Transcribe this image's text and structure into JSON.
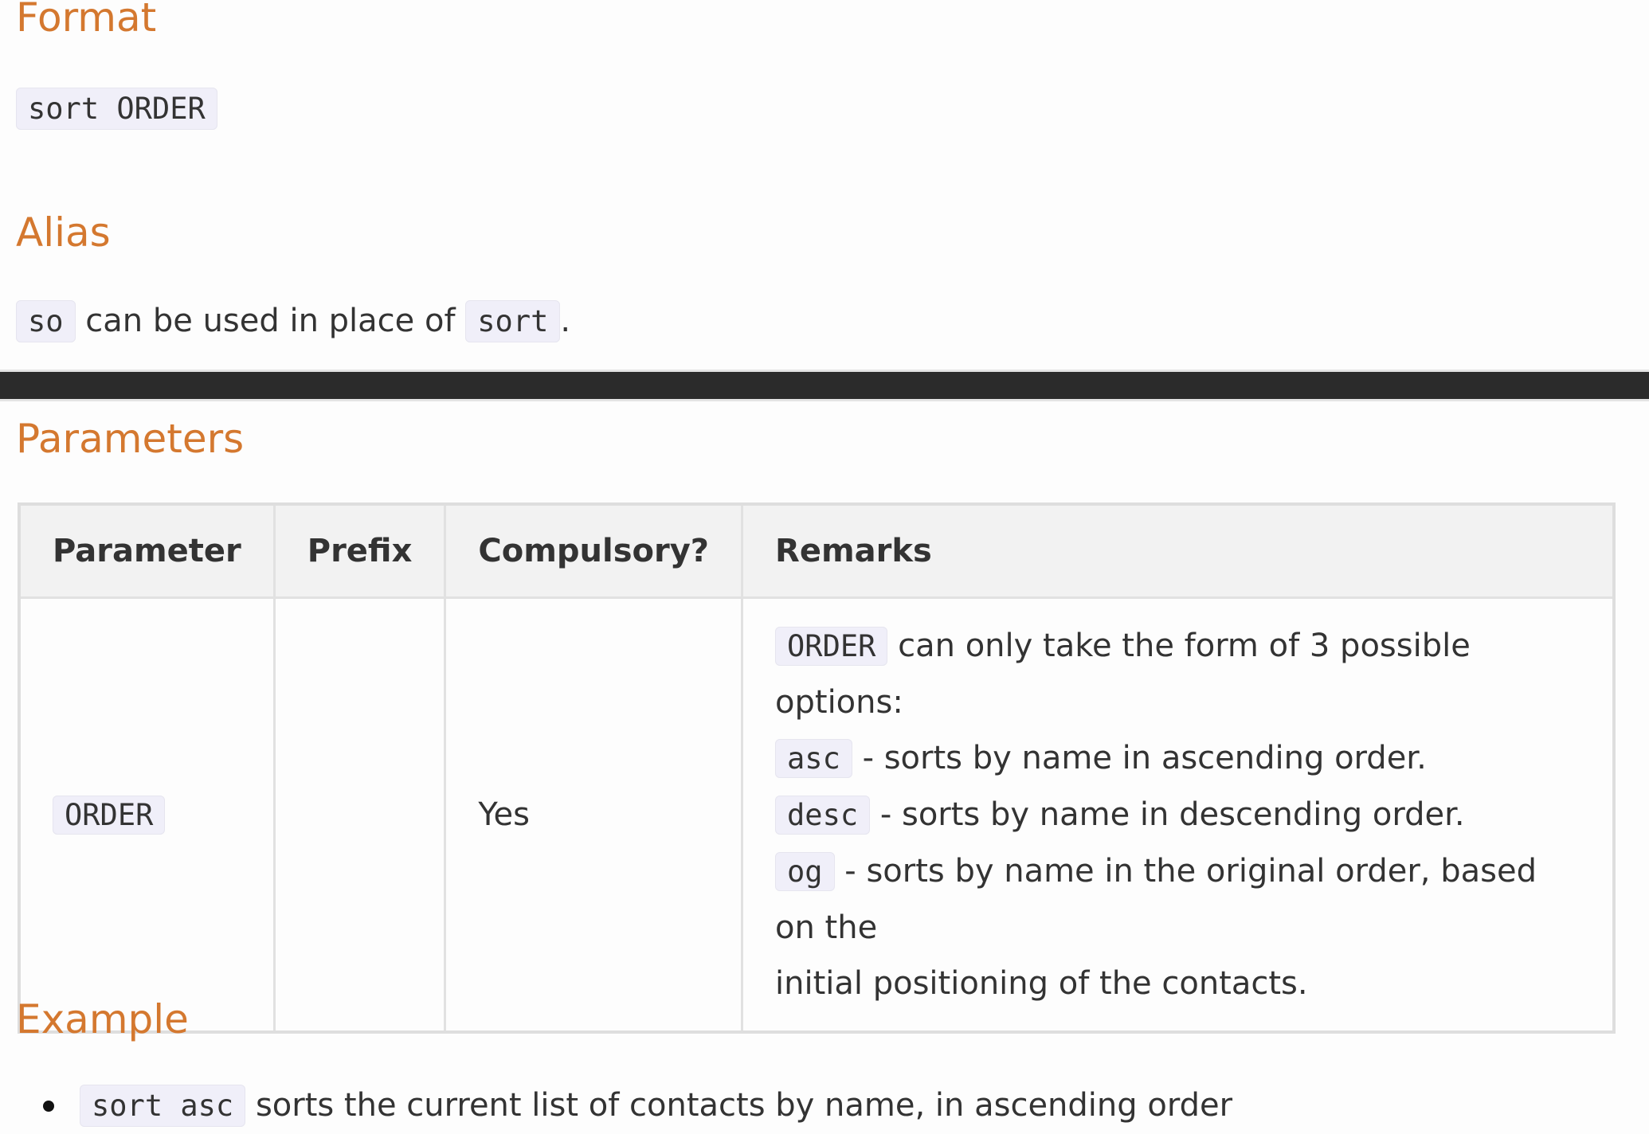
{
  "format": {
    "heading": "Format",
    "command": "sort ORDER"
  },
  "alias": {
    "heading": "Alias",
    "alias_code": "so",
    "text_middle": "can be used in place of",
    "original_code": "sort",
    "text_end": "."
  },
  "parameters": {
    "heading": "Parameters",
    "columns": [
      "Parameter",
      "Prefix",
      "Compulsory?",
      "Remarks"
    ],
    "row": {
      "parameter": "ORDER",
      "prefix": "",
      "compulsory": "Yes",
      "remarks": {
        "intro_code": "ORDER",
        "intro_text": "can only take the form of 3 possible options:",
        "options": [
          {
            "code": "asc",
            "text": "- sorts by name in ascending order."
          },
          {
            "code": "desc",
            "text": "- sorts by name in descending order."
          },
          {
            "code": "og",
            "text": "- sorts by name in the original order, based on the"
          }
        ],
        "continuation": "initial positioning of the contacts."
      }
    }
  },
  "example": {
    "heading": "Example",
    "items": [
      {
        "code": "sort asc",
        "text": "sorts the current list of contacts by name, in ascending order"
      }
    ]
  },
  "colors": {
    "heading": "#d4782f",
    "code_background": "#f0eff9",
    "divider": "#2b2b2b",
    "table_header_background": "#f2f2f2"
  }
}
